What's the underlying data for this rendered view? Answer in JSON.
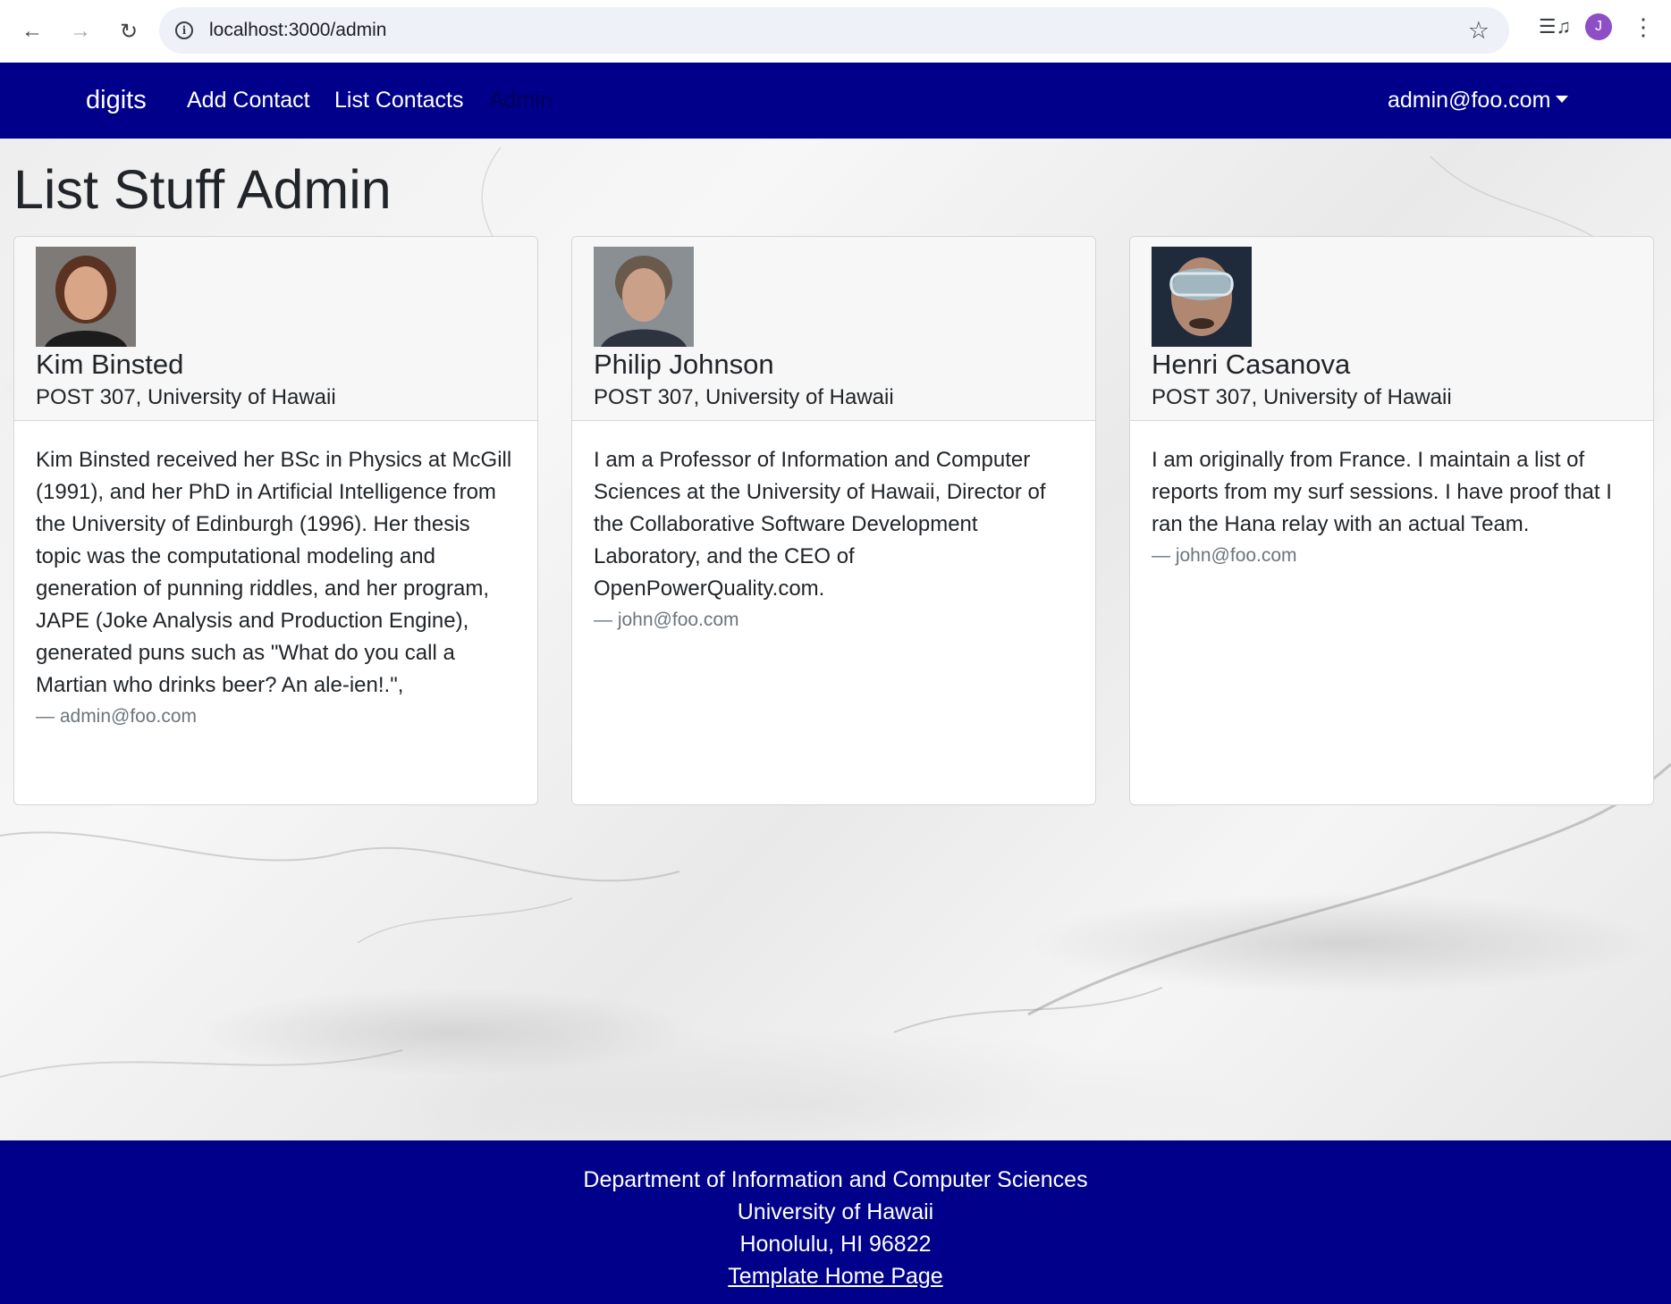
{
  "browser": {
    "url": "localhost:3000/admin",
    "profile_initial": "J"
  },
  "navbar": {
    "brand": "digits",
    "links": [
      "Add Contact",
      "List Contacts",
      "Admin"
    ],
    "user": "admin@foo.com"
  },
  "page": {
    "title": "List Stuff Admin"
  },
  "contacts": [
    {
      "name": "Kim Binsted",
      "address": "POST 307, University of Hawaii",
      "description": "Kim Binsted received her BSc in Physics at McGill (1991), and her PhD in Artificial Intelligence from the University of Edinburgh (1996). Her thesis topic was the computational modeling and generation of punning riddles, and her program, JAPE (Joke Analysis and Production Engine), generated puns such as \"What do you call a Martian who drinks beer? An ale-ien!.\",",
      "owner": "— admin@foo.com"
    },
    {
      "name": "Philip Johnson",
      "address": "POST 307, University of Hawaii",
      "description": "I am a Professor of Information and Computer Sciences at the University of Hawaii, Director of the Collaborative Software Development Laboratory, and the CEO of OpenPowerQuality.com.",
      "owner": "— john@foo.com"
    },
    {
      "name": "Henri Casanova",
      "address": "POST 307, University of Hawaii",
      "description": "I am originally from France. I maintain a list of reports from my surf sessions. I have proof that I ran the Hana relay with an actual Team.",
      "owner": "— john@foo.com"
    }
  ],
  "footer": {
    "line1": "Department of Information and Computer Sciences",
    "line2": "University of Hawaii",
    "line3": "Honolulu, HI 96822",
    "link": "Template Home Page"
  },
  "colors": {
    "navbar_bg": "#00008b",
    "footer_bg": "#00008b",
    "text": "#212529",
    "muted": "#6c757d"
  }
}
